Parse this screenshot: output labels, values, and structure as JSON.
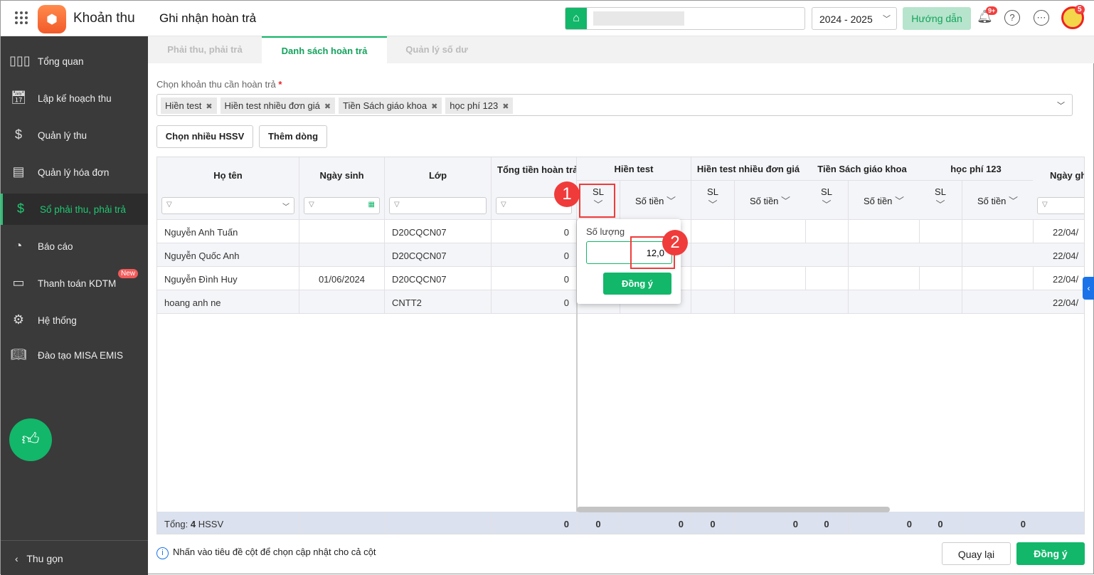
{
  "header": {
    "app_title": "Khoản thu",
    "page_title": "Ghi nhận hoàn trả",
    "school_year": "2024 - 2025",
    "guide_label": "Hướng dẫn",
    "notification_badge": "9+",
    "avatar_badge": "5"
  },
  "sidebar": {
    "items": [
      {
        "label": "Tổng quan"
      },
      {
        "label": "Lập kế hoạch thu"
      },
      {
        "label": "Quản lý thu"
      },
      {
        "label": "Quản lý hóa đơn"
      },
      {
        "label": "Sổ phải thu, phải trả"
      },
      {
        "label": "Báo cáo"
      },
      {
        "label": "Thanh toán KDTM",
        "badge": "New"
      },
      {
        "label": "Hệ thống"
      },
      {
        "label": "Đào tạo MISA EMIS"
      }
    ],
    "collapse_label": "Thu gọn"
  },
  "tabs": [
    {
      "label": "Phải thu, phải trả"
    },
    {
      "label": "Danh sách hoàn trả"
    },
    {
      "label": "Quản lý số dư"
    }
  ],
  "form": {
    "select_label": "Chọn khoản thu cần hoàn trả",
    "required": "*",
    "tags": [
      "Hiền test",
      "Hiền test nhiều đơn giá",
      "Tiền Sách giáo khoa",
      "học phí 123"
    ],
    "btn_multi": "Chọn nhiều HSSV",
    "btn_add": "Thêm dòng"
  },
  "table": {
    "headers": {
      "name": "Họ tên",
      "dob": "Ngày sinh",
      "class": "Lớp",
      "total": "Tổng tiền hoàn trả",
      "date": "Ngày gh"
    },
    "groups": [
      "Hiền test",
      "Hiền test nhiều đơn giá",
      "Tiền Sách giáo khoa",
      "học phí 123"
    ],
    "sub_sl": "SL",
    "sub_amount": "Số tiền",
    "rows": [
      {
        "name": "Nguyễn Anh Tuấn",
        "dob": "",
        "class": "D20CQCN07",
        "total": "0",
        "date": "22/04/"
      },
      {
        "name": "Nguyễn Quốc Anh",
        "dob": "",
        "class": "D20CQCN07",
        "total": "0",
        "date": "22/04/"
      },
      {
        "name": "Nguyễn Đình Huy",
        "dob": "01/06/2024",
        "class": "D20CQCN07",
        "total": "0",
        "date": "22/04/"
      },
      {
        "name": "hoang anh ne",
        "dob": "",
        "class": "CNTT2",
        "total": "0",
        "date": "22/04/"
      }
    ],
    "footer": {
      "label": "Tổng:",
      "count": "4",
      "unit": "HSSV",
      "values": [
        "0",
        "0",
        "0",
        "0",
        "0",
        "0",
        "0",
        "0",
        "0"
      ]
    }
  },
  "popup": {
    "label": "Số lượng",
    "value": "12,0",
    "ok": "Đồng ý"
  },
  "annotations": [
    "1",
    "2"
  ],
  "footer": {
    "hint": "Nhấn vào tiêu đề cột để chọn cập nhật cho cả cột",
    "back": "Quay lại",
    "ok": "Đồng ý"
  }
}
